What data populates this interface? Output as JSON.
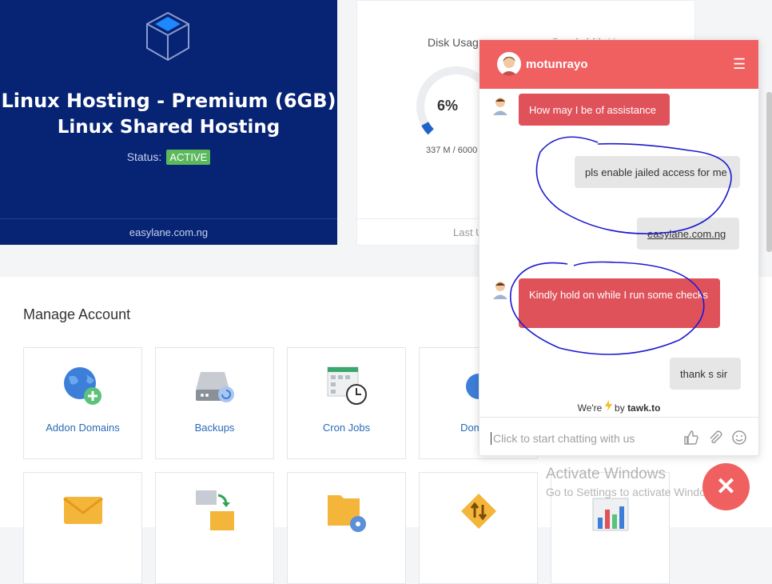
{
  "hosting": {
    "product_title": "Linux Hosting - Premium (6GB)",
    "product_subtitle": "Linux Shared Hosting",
    "status_label": "Status:",
    "status_value": "ACTIVE",
    "domain": "easylane.com.ng"
  },
  "usage": {
    "disk_title": "Disk Usage",
    "bandwidth_title": "Bandwidth U",
    "disk_percent": "6%",
    "disk_fraction": 0.06,
    "disk_values": "337 M / 6000",
    "footer": "Last U"
  },
  "manage": {
    "title": "Manage Account",
    "tiles": [
      {
        "label": "Addon Domains",
        "icon": "globe-plus-icon"
      },
      {
        "label": "Backups",
        "icon": "hard-drive-icon"
      },
      {
        "label": "Cron Jobs",
        "icon": "calendar-clock-icon"
      },
      {
        "label": "Domain",
        "icon": "globe-icon"
      },
      {
        "label": "",
        "icon": "envelope-icon"
      },
      {
        "label": "",
        "icon": "email-forward-icon"
      },
      {
        "label": "",
        "icon": "folder-gear-icon"
      },
      {
        "label": "",
        "icon": "diamond-sort-icon"
      },
      {
        "label": "",
        "icon": "bar-chart-icon"
      }
    ]
  },
  "chat": {
    "agent_name": "motunrayo",
    "messages": [
      {
        "from": "agent",
        "text": "How may I be of assistance"
      },
      {
        "from": "visitor",
        "text": "pls enable jailed access for me"
      },
      {
        "from": "visitor",
        "text": "easylane.com.ng"
      },
      {
        "from": "agent",
        "text": "Kindly hold on while I run some checks"
      },
      {
        "from": "visitor",
        "text": "thank s sir"
      }
    ],
    "powered_prefix": "We're",
    "powered_by": "by",
    "powered_brand": "tawk.to",
    "input_placeholder": "Click to start chatting with us"
  },
  "watermark": {
    "line1": "Activate Windows",
    "line2": "Go to Settings to activate Windows."
  },
  "colors": {
    "hosting_bg": "#062374",
    "chat_accent": "#f06060",
    "agent_bubble": "#e0525a",
    "active_badge": "#5cb85c",
    "link_blue": "#2a6ab8",
    "annotation_ink": "#1a1ad0"
  }
}
